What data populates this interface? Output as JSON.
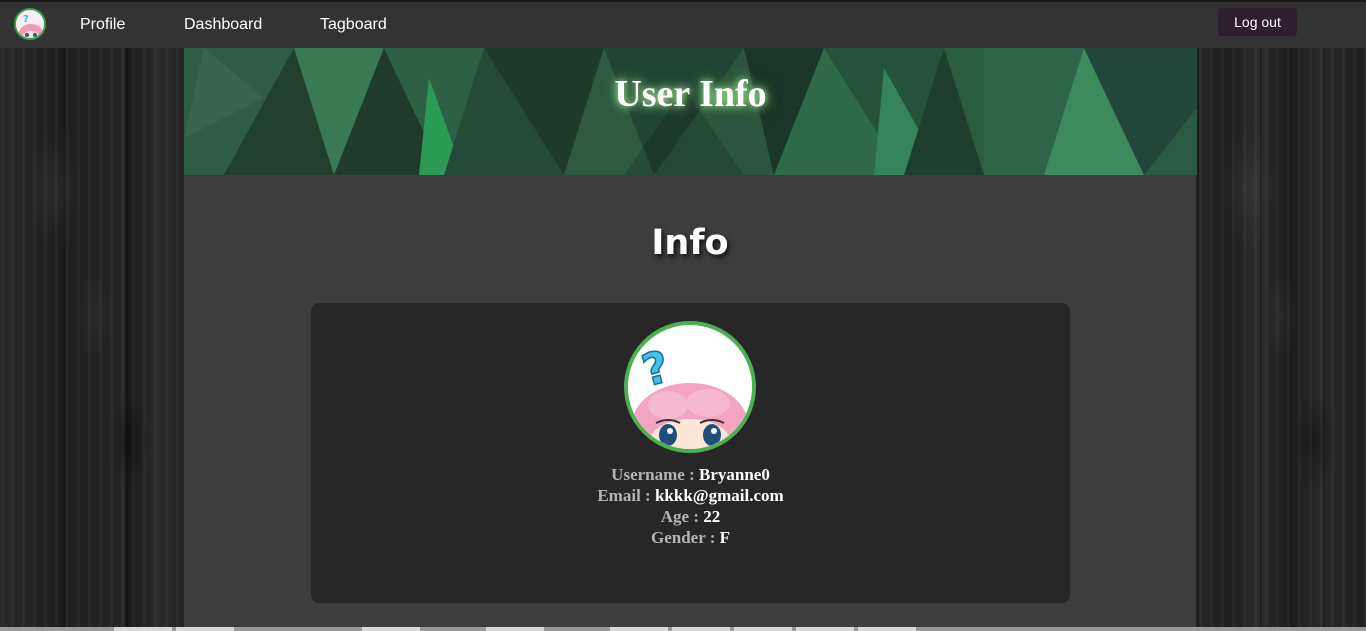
{
  "nav": {
    "links": [
      "Profile",
      "Dashboard",
      "Tagboard"
    ],
    "logout_label": "Log out"
  },
  "banner": {
    "title": "User Info"
  },
  "main": {
    "section_title": "Info",
    "fields": [
      {
        "key": "Username :",
        "value": "Bryanne0"
      },
      {
        "key": "Email :",
        "value": "kkkk@gmail.com"
      },
      {
        "key": "Age :",
        "value": "22"
      },
      {
        "key": "Gender :",
        "value": "F"
      }
    ]
  },
  "colors": {
    "navbar": "#333333",
    "banner_green": "#254a35",
    "panel": "#3d3d3d",
    "card": "#272727",
    "avatar_border": "#4caf50",
    "logout_bg": "#2d1f2d"
  },
  "icons": {
    "nav_logo": "anime-avatar-icon",
    "profile_avatar": "anime-avatar-icon"
  }
}
